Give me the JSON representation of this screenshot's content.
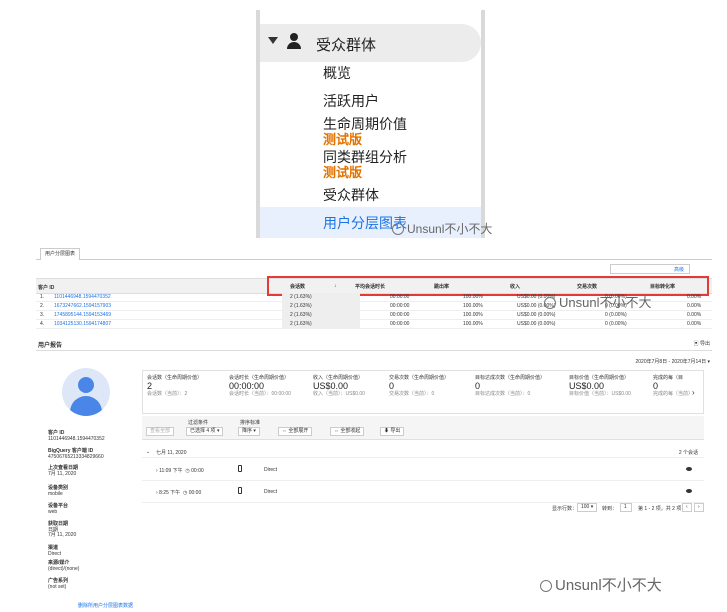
{
  "nav": {
    "section": "受众群体",
    "items": [
      "概览",
      "活跃用户",
      "生命周期价值",
      "同类群组分析",
      "受众群体"
    ],
    "beta": "测试版",
    "active": "用户分层图表"
  },
  "watermark": "Unsunl不小不大",
  "table": {
    "tab": "用户分层图表",
    "advanced": "高级",
    "col_id": "客户 ID",
    "columns": [
      "会话数",
      "平均会话时长",
      "跳出率",
      "收入",
      "交易次数",
      "目标转化率"
    ],
    "rows": [
      {
        "n": "1.",
        "id": "1101446948.1594470352",
        "sessions": "2 (1.63%)",
        "dur": "00:00:00",
        "bounce": "100.00%",
        "rev": "US$0.00 (0.00%)",
        "tx": "0 (0.00%)",
        "conv": "0.00%"
      },
      {
        "n": "2.",
        "id": "1673247662.1594157903",
        "sessions": "2 (1.63%)",
        "dur": "00:00:00",
        "bounce": "100.00%",
        "rev": "US$0.00 (0.00%)",
        "tx": "0 (0.00%)",
        "conv": "0.00%"
      },
      {
        "n": "3.",
        "id": "1745895144.1594153469",
        "sessions": "2 (1.63%)",
        "dur": "00:00:00",
        "bounce": "100.00%",
        "rev": "US$0.00 (0.00%)",
        "tx": "0 (0.00%)",
        "conv": "0.00%"
      },
      {
        "n": "4.",
        "id": "1034125130.1594174807",
        "sessions": "2 (1.63%)",
        "dur": "00:00:00",
        "bounce": "100.00%",
        "rev": "US$0.00 (0.00%)",
        "tx": "0 (0.00%)",
        "conv": "0.00%"
      }
    ]
  },
  "report": {
    "title": "用户报告",
    "export": "导出",
    "date_range": "2020年7月8日 - 2020年7月14日",
    "profile": [
      {
        "k": "客户 ID",
        "v": "1101446948.1594470352"
      },
      {
        "k": "BigQuery 客户端 ID",
        "v": "47506765213334829660"
      },
      {
        "k": "上次查看日期",
        "v": "7月 11, 2020"
      },
      {
        "k": "设备类别",
        "v": "mobile"
      },
      {
        "k": "设备平台",
        "v": "web"
      },
      {
        "k": "获取日期",
        "v": "日期"
      },
      {
        "k": "",
        "v": "7月 11, 2020"
      },
      {
        "k": "渠道",
        "v": "Direct"
      },
      {
        "k": "来源/媒介",
        "v": "(direct)/(none)"
      },
      {
        "k": "广告系列",
        "v": "(not set)"
      }
    ],
    "delete_link": "删除所用户分层图表数据",
    "metrics": [
      {
        "label": "会话数（生命周期价值）",
        "value": "2",
        "sub": "会话数（当前）：2"
      },
      {
        "label": "会话时长（生命周期价值）",
        "value": "00:00:00",
        "sub": "会话时长（当前）：00:00:00"
      },
      {
        "label": "收入（生命周期价值）",
        "value": "US$0.00",
        "sub": "收入（当前）：US$0.00"
      },
      {
        "label": "交易次数（生命周期价值）",
        "value": "0",
        "sub": "交易次数（当前）：0"
      },
      {
        "label": "目标达成次数（生命周期价值）",
        "value": "0",
        "sub": "目标达成次数（当前）：0"
      },
      {
        "label": "目标价值（生命周期价值）",
        "value": "US$0.00",
        "sub": "目标价值（当前）：US$0.00"
      },
      {
        "label": "完成的每（目",
        "value": "0",
        "sub": "完成的每（当前）"
      }
    ],
    "toolbar": {
      "filter_label": "过滤条件",
      "filter_value": "已选择 4 项",
      "sort_label": "排序标准",
      "sort_value": "降序",
      "expand_all": "全部展开",
      "collapse_all": "全部收起",
      "export": "导出",
      "view_all": "查看全部"
    },
    "day": "七月 11, 2020",
    "day_count": "2 个会话",
    "sessions": [
      {
        "time": "11:09 下午",
        "duration": "00:00",
        "source": "Direct"
      },
      {
        "time": "8:25 下午",
        "duration": "00:00",
        "source": "Direct"
      }
    ],
    "pager": {
      "rows_label": "显示行数：",
      "rows": "100",
      "goto_label": "转到：",
      "goto": "1",
      "range": "第 1 - 2 项，共 2 项"
    }
  }
}
